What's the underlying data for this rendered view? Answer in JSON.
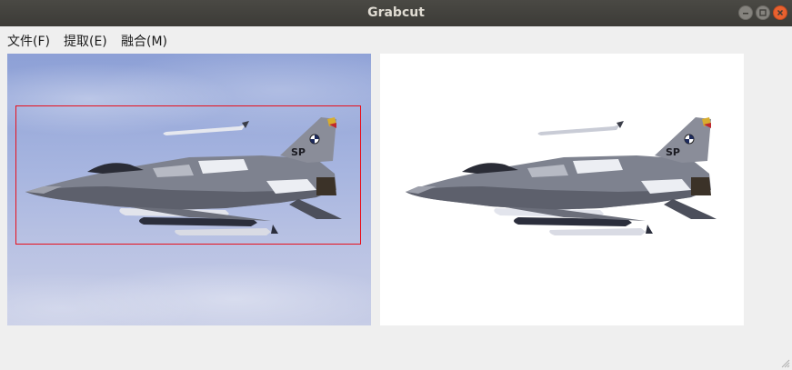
{
  "window": {
    "title": "Grabcut"
  },
  "menubar": {
    "items": [
      {
        "label": "文件(F)"
      },
      {
        "label": "提取(E)"
      },
      {
        "label": "融合(M)"
      }
    ]
  },
  "jet": {
    "tail_code": "SP"
  }
}
